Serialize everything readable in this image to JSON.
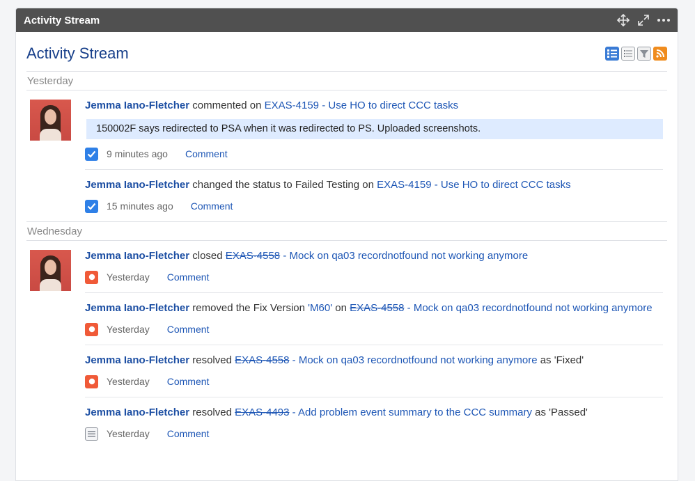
{
  "gadget": {
    "header_title": "Activity Stream",
    "title": "Activity Stream",
    "header_icons": [
      "move-icon",
      "expand-icon",
      "more-icon"
    ],
    "view_icons": [
      "full-view-icon",
      "list-view-icon",
      "filter-icon",
      "rss-icon"
    ]
  },
  "days": [
    {
      "label": "Yesterday",
      "entries": [
        {
          "user": "Jemma Iano-Fletcher",
          "action": "commented on",
          "issue_key": "EXAS-4159",
          "issue_title": " - Use HO to direct CCC tasks",
          "quote": "150002F says redirected to PSA when it was redirected to PS. Uploaded screenshots.",
          "icon": "task-check-icon",
          "time": "9 minutes ago",
          "comment_label": "Comment"
        },
        {
          "user": "Jemma Iano-Fletcher",
          "action": "changed the status to Failed Testing on",
          "issue_key": "EXAS-4159",
          "issue_title": " - Use HO to direct CCC tasks",
          "icon": "task-check-icon",
          "time": "15 minutes ago",
          "comment_label": "Comment"
        }
      ]
    },
    {
      "label": "Wednesday",
      "entries": [
        {
          "user": "Jemma Iano-Fletcher",
          "action": "closed",
          "issue_key": "EXAS-4558",
          "issue_title": " - Mock on qa03 recordnotfound not working anymore",
          "icon": "bug-icon",
          "time": "Yesterday",
          "comment_label": "Comment"
        },
        {
          "user": "Jemma Iano-Fletcher",
          "action": "removed the Fix Version",
          "version": "'M60'",
          "action_suffix": "on",
          "issue_key": "EXAS-4558",
          "issue_title": " - Mock on qa03 recordnotfound not working anymore",
          "icon": "bug-icon",
          "time": "Yesterday",
          "comment_label": "Comment"
        },
        {
          "user": "Jemma Iano-Fletcher",
          "action": "resolved",
          "issue_key": "EXAS-4558",
          "issue_title": " - Mock on qa03 recordnotfound not working anymore",
          "resolution": "as 'Fixed'",
          "icon": "bug-icon",
          "time": "Yesterday",
          "comment_label": "Comment"
        },
        {
          "user": "Jemma Iano-Fletcher",
          "action": "resolved",
          "issue_key": "EXAS-4493",
          "issue_title": " - Add problem event summary to the CCC summary",
          "resolution": "as 'Passed'",
          "icon": "story-icon",
          "time": "Yesterday",
          "comment_label": "Comment"
        }
      ]
    }
  ]
}
